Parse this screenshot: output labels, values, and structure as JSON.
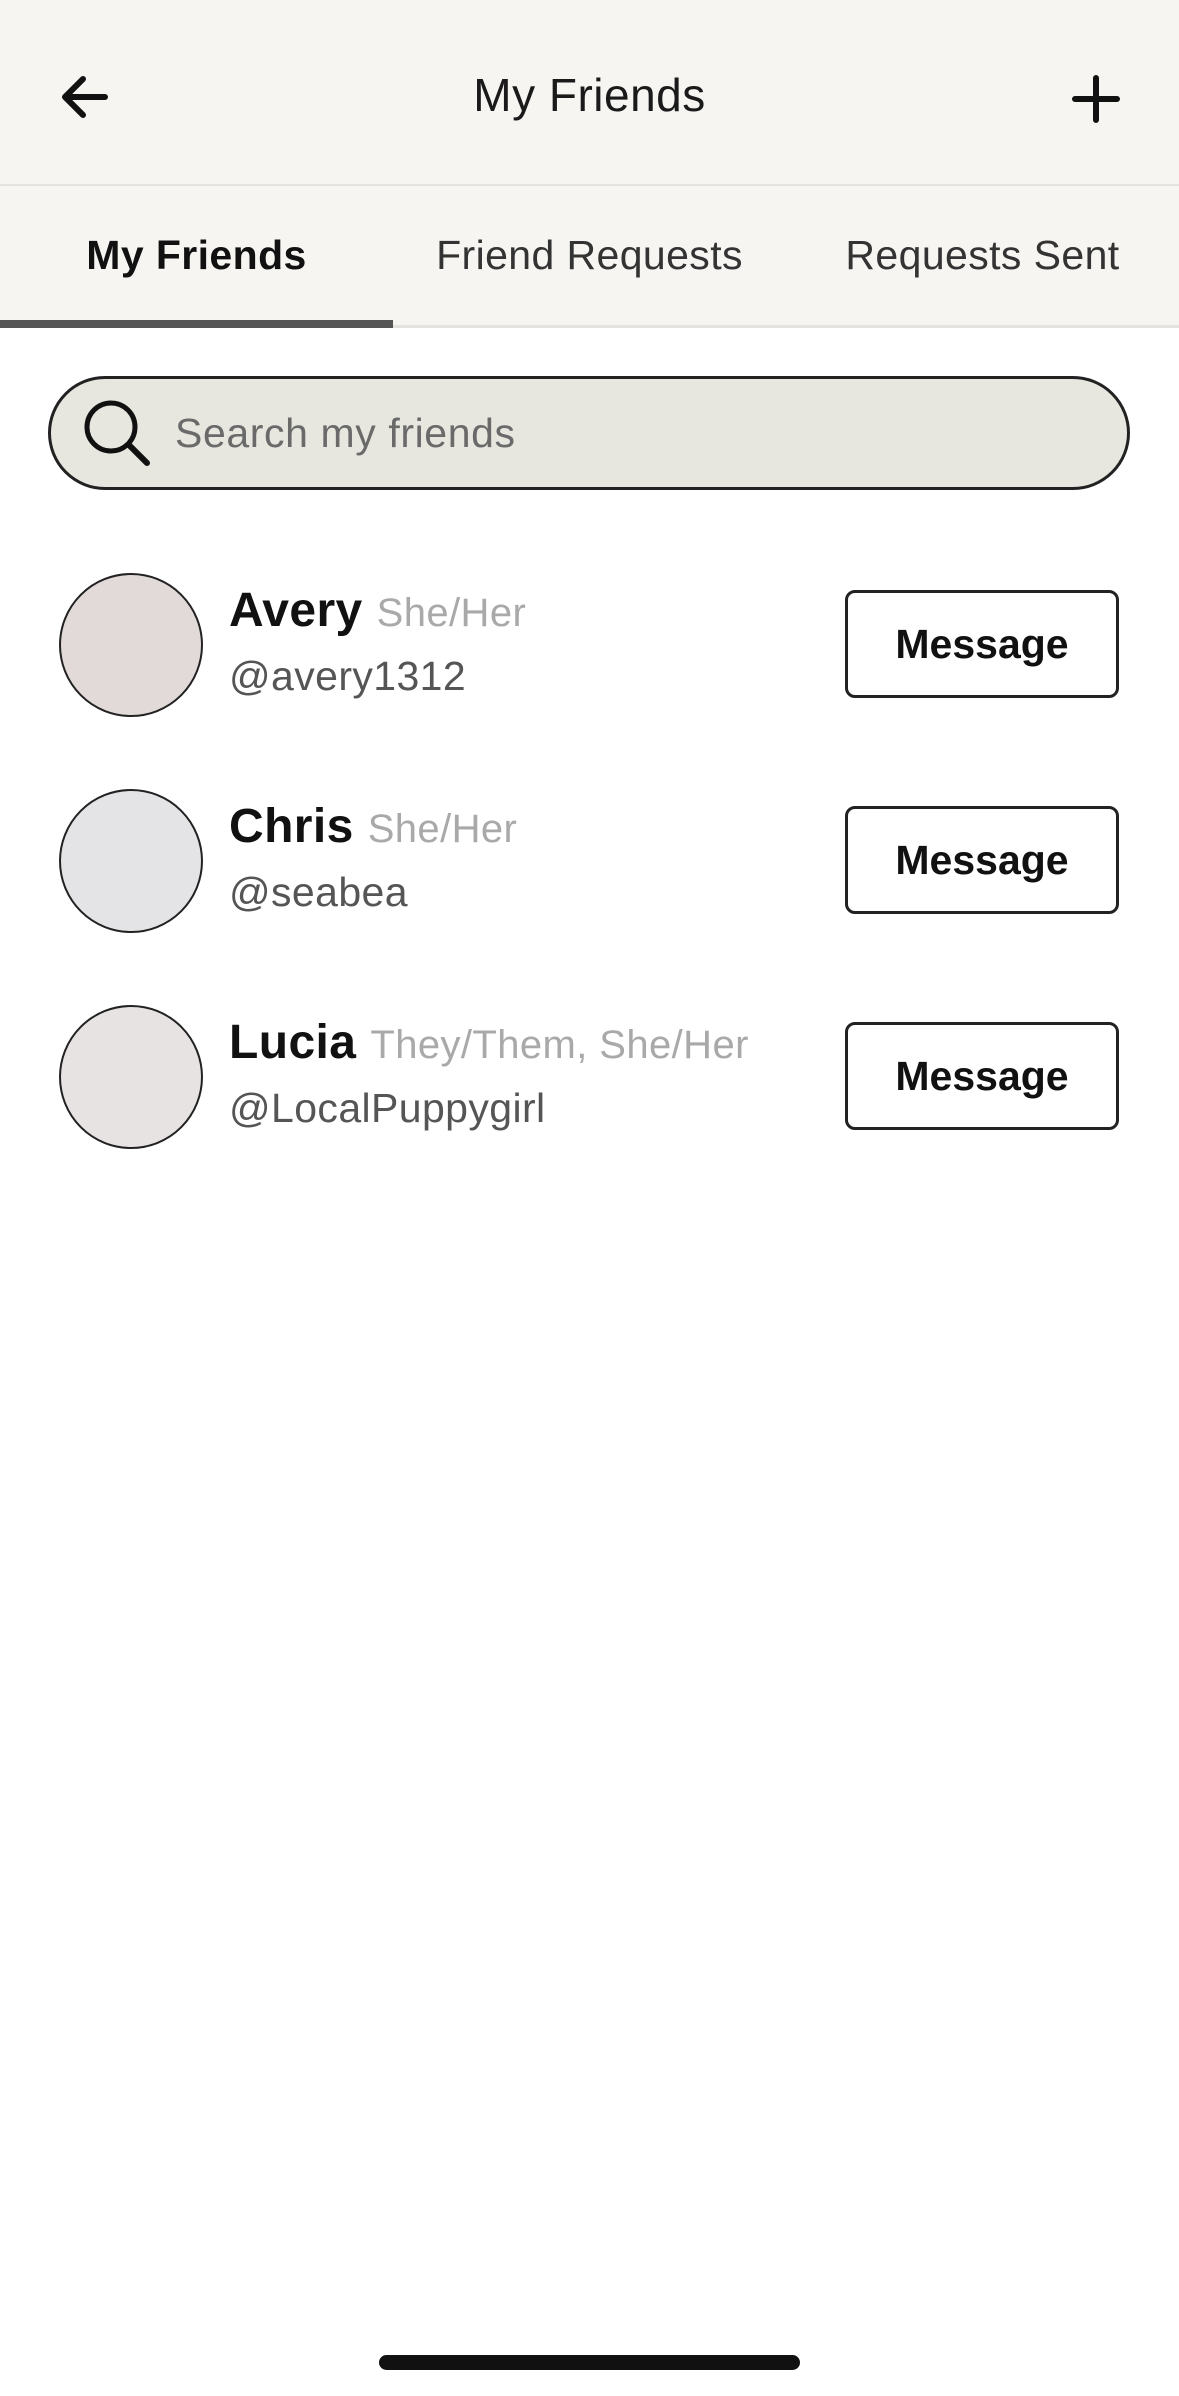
{
  "header": {
    "title": "My Friends",
    "back_icon": "arrow-left-icon",
    "add_icon": "plus-icon"
  },
  "tabs": [
    {
      "label": "My Friends",
      "active": true
    },
    {
      "label": "Friend Requests",
      "active": false
    },
    {
      "label": "Requests Sent",
      "active": false
    }
  ],
  "search": {
    "placeholder": "Search my friends",
    "value": "",
    "icon": "search-icon"
  },
  "friends": [
    {
      "name": "Avery",
      "pronouns": "She/Her",
      "handle": "@avery1312",
      "button_label": "Message",
      "avatar_color": "#e2d9d9"
    },
    {
      "name": "Chris",
      "pronouns": "She/Her",
      "handle": "@seabea",
      "button_label": "Message",
      "avatar_color": "#e4e4e6"
    },
    {
      "name": "Lucia",
      "pronouns": "They/Them, She/Her",
      "handle": "@LocalPuppygirl",
      "button_label": "Message",
      "avatar_color": "#e8e3e3"
    }
  ],
  "colors": {
    "header_bg": "#f6f5f2",
    "search_bg": "#e7e7df",
    "tab_indicator": "#555555",
    "pronoun_text": "#a9a9a9"
  }
}
